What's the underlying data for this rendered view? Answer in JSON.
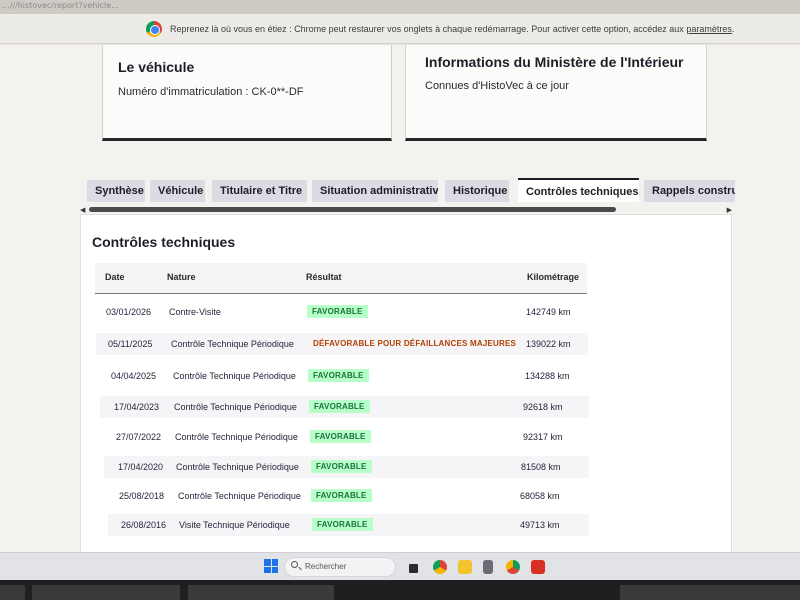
{
  "browser": {
    "url_fragment": "...///histovec/report?vehicle...",
    "restore_bar": {
      "message": "Reprenez là où vous en étiez : Chrome peut restaurer vos onglets à chaque redémarrage. Pour activer cette option, accédez aux",
      "link": "paramètres",
      "end": "."
    }
  },
  "vehicle_card": {
    "title": "Le véhicule",
    "text": "Numéro d'immatriculation : CK-0**-DF"
  },
  "ministry_card": {
    "title": "Informations du Ministère de l'Intérieur",
    "text": "Connues d'HistoVec à ce jour"
  },
  "tabs": [
    {
      "label": "Synthèse",
      "active": false
    },
    {
      "label": "Véhicule",
      "active": false
    },
    {
      "label": "Titulaire et Titre",
      "active": false
    },
    {
      "label": "Situation administrative",
      "active": false
    },
    {
      "label": "Historique",
      "active": false
    },
    {
      "label": "Contrôles techniques",
      "active": true
    },
    {
      "label": "Rappels constructeur",
      "active": false
    }
  ],
  "scroll_arrows": {
    "left": "◀",
    "right": "▶"
  },
  "controls": {
    "title": "Contrôles techniques",
    "headers": {
      "date": "Date",
      "nature": "Nature",
      "result": "Résultat",
      "km": "Kilométrage"
    },
    "rows": [
      {
        "date": "03/01/2026",
        "nature": "Contre-Visite",
        "result": "FAVORABLE",
        "status": "ok",
        "km": "142749 km"
      },
      {
        "date": "05/11/2025",
        "nature": "Contrôle Technique Périodique",
        "result": "DÉFAVORABLE POUR DÉFAILLANCES MAJEURES",
        "status": "ko",
        "km": "139022 km"
      },
      {
        "date": "04/04/2025",
        "nature": "Contrôle Technique Périodique",
        "result": "FAVORABLE",
        "status": "ok",
        "km": "134288 km"
      },
      {
        "date": "17/04/2023",
        "nature": "Contrôle Technique Périodique",
        "result": "FAVORABLE",
        "status": "ok",
        "km": "92618 km"
      },
      {
        "date": "27/07/2022",
        "nature": "Contrôle Technique Périodique",
        "result": "FAVORABLE",
        "status": "ok",
        "km": "92317 km"
      },
      {
        "date": "17/04/2020",
        "nature": "Contrôle Technique Périodique",
        "result": "FAVORABLE",
        "status": "ok",
        "km": "81508 km"
      },
      {
        "date": "25/08/2018",
        "nature": "Contrôle Technique Périodique",
        "result": "FAVORABLE",
        "status": "ok",
        "km": "68058 km"
      },
      {
        "date": "26/08/2016",
        "nature": "Visite Technique Périodique",
        "result": "FAVORABLE",
        "status": "ok",
        "km": "49713 km"
      }
    ]
  },
  "taskbar": {
    "search_placeholder": "Rechercher",
    "apps": [
      {
        "icon": "task-view-icon",
        "color": "#2b2b2b"
      },
      {
        "icon": "chrome-icon",
        "color": "#db4437"
      },
      {
        "icon": "file-explorer-icon",
        "color": "#f4c430"
      },
      {
        "icon": "store-icon",
        "color": "#6b6b75"
      },
      {
        "icon": "chrome-icon",
        "color": "#0f9d58"
      },
      {
        "icon": "red-app-icon",
        "color": "#d93025"
      }
    ]
  },
  "colors": {
    "accent": "#1e1e28",
    "favorable_bg": "#b8fec9",
    "favorable_text": "#18753c",
    "defavorable_text": "#b34000"
  }
}
